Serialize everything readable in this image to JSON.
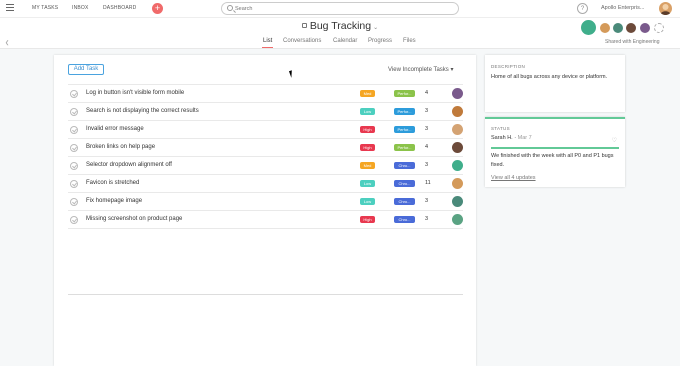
{
  "nav": {
    "my_tasks": "MY TASKS",
    "inbox": "INBOX",
    "dashboard": "DASHBOARD",
    "add": "+",
    "search_placeholder": "Search",
    "help": "?",
    "org_name": "Apollo Enterpris..."
  },
  "project": {
    "title": "Bug Tracking",
    "tabs": [
      "List",
      "Conversations",
      "Calendar",
      "Progress",
      "Files"
    ],
    "active_tab": "List",
    "shared_text": "Shared with Engineering"
  },
  "list": {
    "add_task_label": "Add Task",
    "view_label": "View Incomplete Tasks ▾",
    "tasks": [
      {
        "name": "Log in button isn't visible form mobile",
        "priority": "Med",
        "platform": "Perfor...",
        "count": "4",
        "pri_color": "#f5a623",
        "plat_color": "#8bc34a",
        "av_color": "#7a5a8c"
      },
      {
        "name": "Search is not displaying the correct results",
        "priority": "Low",
        "platform": "Perfor...",
        "count": "3",
        "pri_color": "#4ccfbf",
        "plat_color": "#2d9cdb",
        "av_color": "#c07a3b"
      },
      {
        "name": "Invalid error message",
        "priority": "High",
        "platform": "Perfor...",
        "count": "3",
        "pri_color": "#e8384f",
        "plat_color": "#2d9cdb",
        "av_color": "#d4a373"
      },
      {
        "name": "Broken links on help page",
        "priority": "High",
        "platform": "Perfor...",
        "count": "4",
        "pri_color": "#e8384f",
        "plat_color": "#8bc34a",
        "av_color": "#6c4a3a"
      },
      {
        "name": "Selector dropdown alignment off",
        "priority": "Med",
        "platform": "Chro...",
        "count": "3",
        "pri_color": "#f5a623",
        "plat_color": "#4a6bd8",
        "av_color": "#3fae8b"
      },
      {
        "name": "Favicon is stretched",
        "priority": "Low",
        "platform": "Chro...",
        "count": "11",
        "pri_color": "#4ccfbf",
        "plat_color": "#4a6bd8",
        "av_color": "#d49a5a"
      },
      {
        "name": "Fix homepage image",
        "priority": "Low",
        "platform": "Chro...",
        "count": "3",
        "pri_color": "#4ccfbf",
        "plat_color": "#4a6bd8",
        "av_color": "#4a8a7a"
      },
      {
        "name": "Missing screenshot on product page",
        "priority": "High",
        "platform": "Chro...",
        "count": "3",
        "pri_color": "#e8384f",
        "plat_color": "#4a6bd8",
        "av_color": "#5aa383"
      }
    ]
  },
  "description": {
    "label": "DESCRIPTION",
    "text": "Home of all bugs across any device or platform."
  },
  "status": {
    "label": "STATUS",
    "author": "Sarah H.",
    "date": "Mar 7",
    "text": "We finished with the week with all P0 and P1 bugs fixed.",
    "view_updates": "View all 4 updates"
  },
  "colors": {
    "accent": "#f06a6a",
    "status_green": "#62c997",
    "link_blue": "#3a8fd0"
  },
  "icons": [
    "hamburger-icon",
    "search-icon",
    "lock-icon",
    "chevron-down-icon",
    "heart-icon",
    "check-icon",
    "help-icon"
  ]
}
